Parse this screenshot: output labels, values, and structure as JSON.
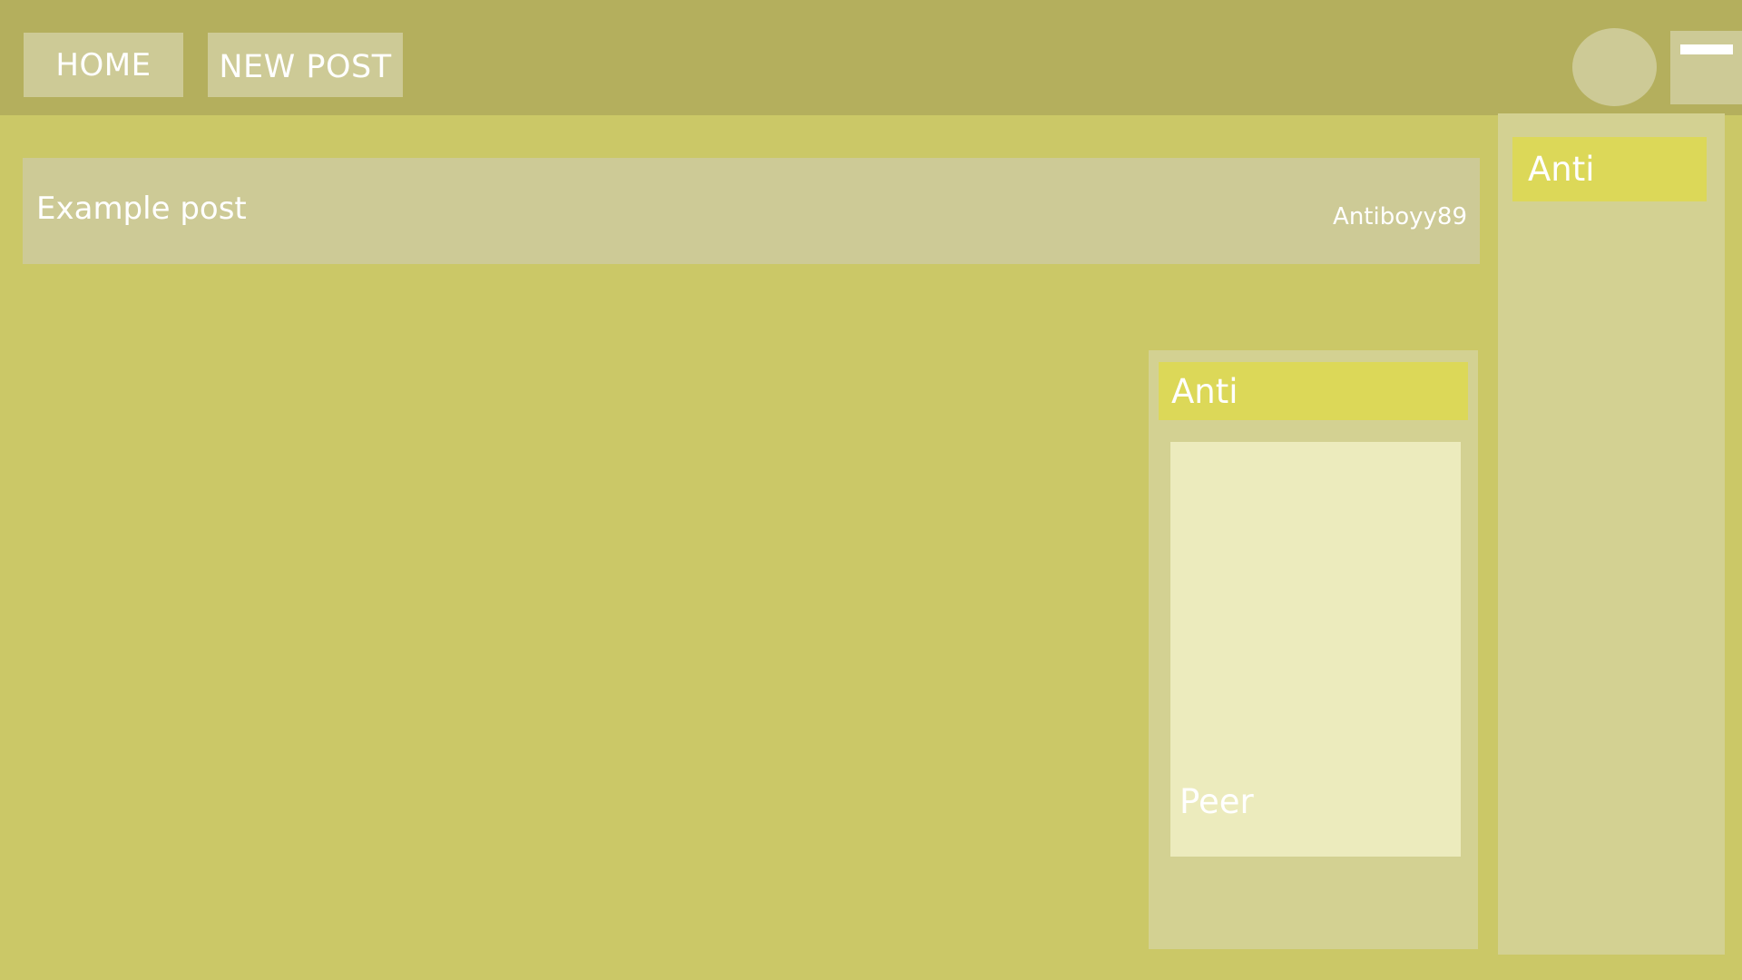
{
  "header": {
    "nav": {
      "home_label": "HOME",
      "new_post_label": "NEW POST"
    },
    "avatar_icon": "avatar-icon",
    "menu_icon": "hamburger-menu-icon"
  },
  "sidebar": {
    "header_label": "Anti"
  },
  "feed": {
    "posts": [
      {
        "title": "Example post",
        "author": "Antiboyy89"
      }
    ]
  },
  "profile_card": {
    "header_label": "Anti",
    "image_caption": "Peer"
  },
  "colors": {
    "background": "#cbc867",
    "topbar": "#b4af5d",
    "panel": "#d3d192",
    "button": "#cdca96",
    "accent": "#dcd858",
    "image_placeholder": "#ecebbd",
    "text": "#ffffff"
  }
}
